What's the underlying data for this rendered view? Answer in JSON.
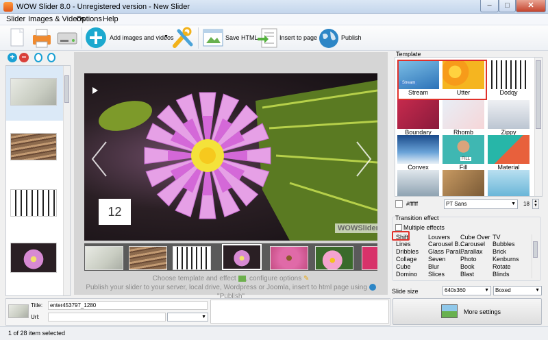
{
  "window": {
    "title": "WOW Slider 8.0 - Unregistered version - New Slider",
    "minimize": "–",
    "maximize": "□",
    "close": "✕"
  },
  "menu": [
    "Slider",
    "Images & Videos",
    "Options",
    "Help"
  ],
  "toolbar": {
    "add_label": "Add images and videos",
    "save_html_label": "Save HTML",
    "insert_label": "Insert to page",
    "publish_label": "Publish"
  },
  "preview": {
    "slide_number": "12",
    "watermark": "WOWSlider",
    "hint_line1": "Choose template and effect",
    "hint_line1b": ", configure options",
    "hint_line2": "Publish your slider to your server, local drive, Wordpress or Joomla, insert to html page using",
    "hint_line2b": "\"Publish\""
  },
  "template": {
    "section_label": "Template",
    "items": [
      "Stream",
      "Utter",
      "Dodqy",
      "Boundary",
      "Rhomb",
      "Zippy",
      "Convex",
      "Fill",
      "Material"
    ],
    "stream_badge": "Stream",
    "fill_badge": "FILL",
    "color_value": "#ffffff",
    "font_value": "PT Sans",
    "font_size": "18"
  },
  "transition": {
    "section_label": "Transition effect",
    "multiple_label": "Multiple effects",
    "col1": [
      "Shift",
      "Lines",
      "Dribbles",
      "Collage",
      "Cube",
      "Domino"
    ],
    "col2": [
      "Louvers",
      "Carousel B...",
      "Glass Paral...",
      "Seven",
      "Blur",
      "Slices"
    ],
    "col3": [
      "Cube Over",
      "Carousel",
      "Parallax",
      "Photo",
      "Book",
      "Blast"
    ],
    "col4": [
      "TV",
      "Bubbles",
      "Brick",
      "Kenburns",
      "Rotate",
      "Blinds"
    ]
  },
  "slide_size": {
    "label": "Slide size",
    "size_value": "640x360",
    "mode_value": "Boxed"
  },
  "more_settings": "More settings",
  "details": {
    "title_label": "Title:",
    "title_value": "enter453797_1280",
    "url_label": "Url:"
  },
  "status": "1 of 28 item selected",
  "colors": {
    "accent_blue": "#1aa0d4",
    "highlight_red": "#e0312a",
    "add_green": "#18a8c8"
  }
}
